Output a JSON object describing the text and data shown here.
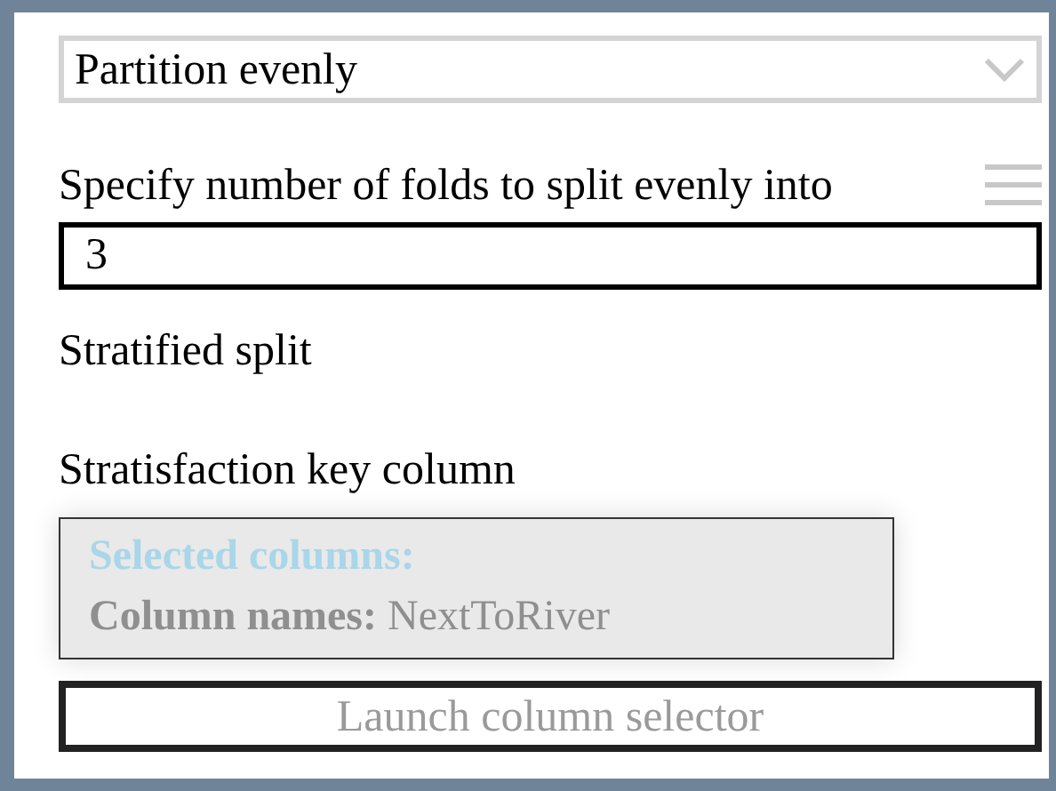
{
  "partition_dropdown": {
    "value": "Partition evenly"
  },
  "folds": {
    "label": "Specify number of folds to split evenly into",
    "value": "3"
  },
  "stratified_split": {
    "label": "Stratified split"
  },
  "key_column": {
    "label": "Stratisfaction key column",
    "selection_title": "Selected columns:",
    "selection_detail": "**Column names:** NextToRiver",
    "button": "Launch column selector"
  }
}
